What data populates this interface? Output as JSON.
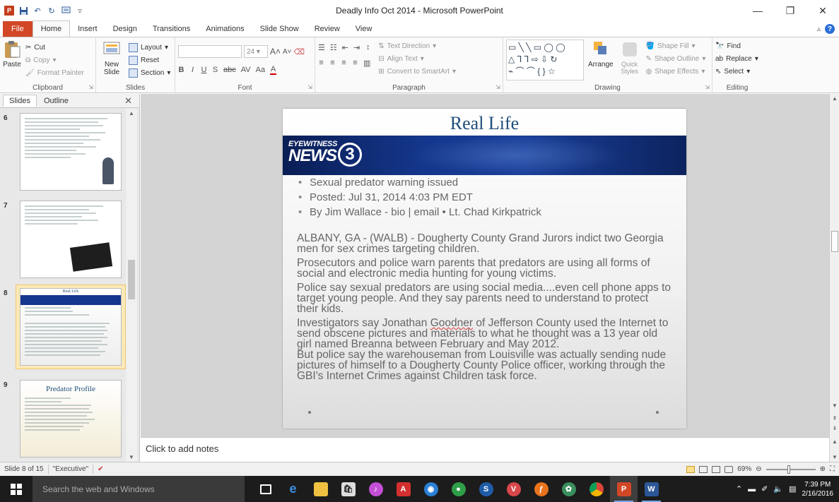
{
  "window": {
    "title": "Deadly Info Oct 2014 - Microsoft PowerPoint"
  },
  "ribbon_tabs": [
    "File",
    "Home",
    "Insert",
    "Design",
    "Transitions",
    "Animations",
    "Slide Show",
    "Review",
    "View"
  ],
  "ribbon": {
    "clipboard": {
      "paste": "Paste",
      "cut": "Cut",
      "copy": "Copy",
      "format_painter": "Format Painter",
      "label": "Clipboard"
    },
    "slides": {
      "new_slide": "New Slide",
      "layout": "Layout",
      "reset": "Reset",
      "section": "Section",
      "label": "Slides"
    },
    "font": {
      "size": "24",
      "label": "Font"
    },
    "paragraph": {
      "text_direction": "Text Direction",
      "align_text": "Align Text",
      "convert_smartart": "Convert to SmartArt",
      "label": "Paragraph"
    },
    "drawing": {
      "arrange": "Arrange",
      "quick_styles": "Quick Styles",
      "shape_fill": "Shape Fill",
      "shape_outline": "Shape Outline",
      "shape_effects": "Shape Effects",
      "label": "Drawing"
    },
    "editing": {
      "find": "Find",
      "replace": "Replace",
      "select": "Select",
      "label": "Editing"
    }
  },
  "left_pane": {
    "tabs": [
      "Slides",
      "Outline"
    ],
    "thumbnails": [
      {
        "number": "6"
      },
      {
        "number": "7"
      },
      {
        "number": "8",
        "title": "Real Life"
      },
      {
        "number": "9",
        "title": "Predator Profile"
      }
    ]
  },
  "slide": {
    "title": "Real Life",
    "banner_line1": "EYEWITNESS",
    "banner_line2": "NEWS",
    "banner_number": "3",
    "bullets": [
      "Sexual predator warning issued",
      "Posted: Jul 31, 2014 4:03 PM EDT",
      "By Jim Wallace - bio | email  •  Lt. Chad Kirkpatrick"
    ],
    "paragraphs": {
      "p1": "ALBANY, GA - (WALB) - Dougherty County Grand Jurors indict two Georgia men for sex crimes targeting children.",
      "p2": "Prosecutors and police warn parents that predators are using all forms of social and electronic media hunting for young victims.",
      "p3": "Police say sexual predators are using social media....even cell phone apps to target young people.  And they say parents need to understand to protect their kids.",
      "p4_before": "Investigators say Jonathan ",
      "p4_name": "Goodner",
      "p4_after": " of Jefferson County used the Internet to send obscene pictures and materials to what he thought was a 13 year old girl named Breanna between February and May 2012.",
      "p5": "But police say the warehouseman  from Louisville was actually sending nude pictures of himself to a Dougherty County Police officer, working through the GBI's Internet Crimes against Children task force."
    }
  },
  "notes": {
    "placeholder": "Click to add notes"
  },
  "status": {
    "slide_info": "Slide 8 of 15",
    "theme": "\"Executive\"",
    "zoom": "69%"
  },
  "taskbar": {
    "search_placeholder": "Search the web and Windows",
    "time": "7:39 PM",
    "date": "2/16/2016"
  }
}
